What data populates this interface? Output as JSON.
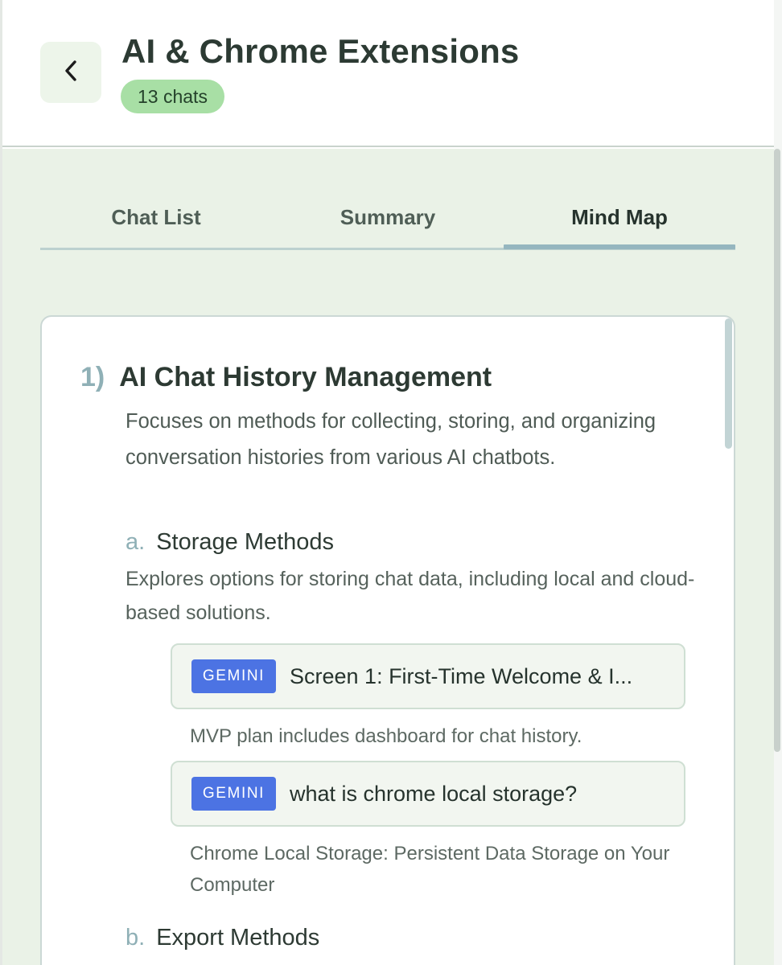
{
  "header": {
    "title": "AI & Chrome Extensions",
    "chat_count": "13 chats",
    "back_icon": "chevron-left-icon"
  },
  "tabs": [
    {
      "label": "Chat List",
      "active": false
    },
    {
      "label": "Summary",
      "active": false
    },
    {
      "label": "Mind Map",
      "active": true
    }
  ],
  "mind_map": {
    "sections": [
      {
        "number": "1)",
        "title": "AI Chat History Management",
        "description": "Focuses on methods for collecting, storing, and organizing conversation histories from various AI chatbots.",
        "subsections": [
          {
            "letter": "a.",
            "title": "Storage Methods",
            "description": "Explores options for storing chat data, including local and cloud-based solutions.",
            "chats": [
              {
                "source": "GEMINI",
                "title": "Screen 1: First-Time Welcome & I...",
                "summary": "MVP plan includes dashboard for chat history."
              },
              {
                "source": "GEMINI",
                "title": "what is chrome local storage?",
                "summary": "Chrome Local Storage: Persistent Data Storage on Your Computer"
              }
            ]
          },
          {
            "letter": "b.",
            "title": "Export Methods"
          }
        ]
      }
    ]
  },
  "colors": {
    "accent_green_badge": "#a8dfa5",
    "gemini_badge": "#4c73e3",
    "content_background": "#eaf2e7",
    "tab_indicator": "#95b6bf"
  }
}
